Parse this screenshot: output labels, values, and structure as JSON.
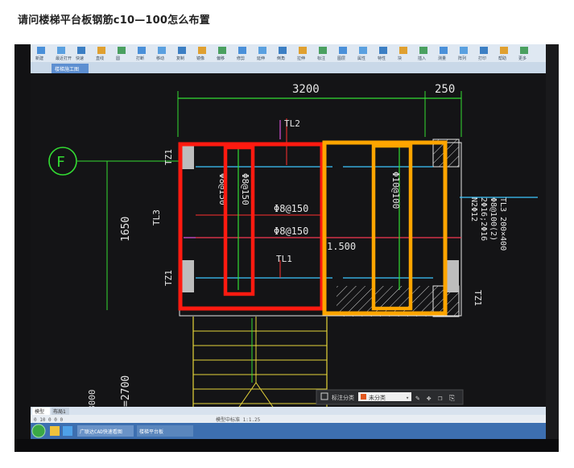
{
  "question": {
    "title": "请问楼梯平台板钢筋c10—100怎么布置"
  },
  "app": {
    "toolbar_items": [
      "新建",
      "最近打开",
      "快速",
      "直线",
      "圆",
      "打断",
      "移动",
      "复制",
      "镜像",
      "偏移",
      "修剪",
      "延伸",
      "倒角",
      "拉伸",
      "标注",
      "图层",
      "属性",
      "特性",
      "块",
      "插入",
      "测量",
      "阵列",
      "打印",
      "帮助",
      "更多"
    ],
    "file_tab": "楼梯施工图",
    "model_tabs": [
      "模型",
      "布局1"
    ],
    "statusbar": {
      "coords": "0  10  0  0  0",
      "message": "模型中标准   1:1.25"
    },
    "taskbar": {
      "item1": "广联达CAD快速看图",
      "item2": "楼梯平台板"
    },
    "float_toolbar": {
      "label1": "标注分类",
      "label2": "未分类"
    }
  },
  "drawing": {
    "axis_label": "F",
    "dims": [
      "3200",
      "250",
      "1650",
      "=2700"
    ],
    "labels": {
      "tl2": "TL2",
      "tl3": "TL3",
      "tl1": "TL1",
      "tz1a": "TZ1",
      "tz1b": "TZ1",
      "tz1c": "TZ1",
      "tz1d": "TZ1",
      "rebar_vert1": "Φ8@150",
      "rebar_vert2": "Φ8@150",
      "rebar_h1": "Φ8@150",
      "rebar_h2": "Φ8@150",
      "rebar_vert3": "Φ10@100",
      "elev": "1.500",
      "tl3_note1": "TL3 200×400",
      "tl3_note2": "Φ8@100(2)",
      "tl3_note3": "2Φ16;2Φ16",
      "tl3_note4": "N2Φ12",
      "left_num": "8000"
    }
  },
  "colors": {
    "cad_bg": "#141416",
    "highlight_red": "#ff1a10",
    "highlight_orange": "#ffa500",
    "line_green": "#33dd33",
    "line_white": "#e6e6e6",
    "line_cyan": "#3cc8ff",
    "line_yellow": "#e5d43a",
    "line_magenta": "#d64fd6"
  }
}
